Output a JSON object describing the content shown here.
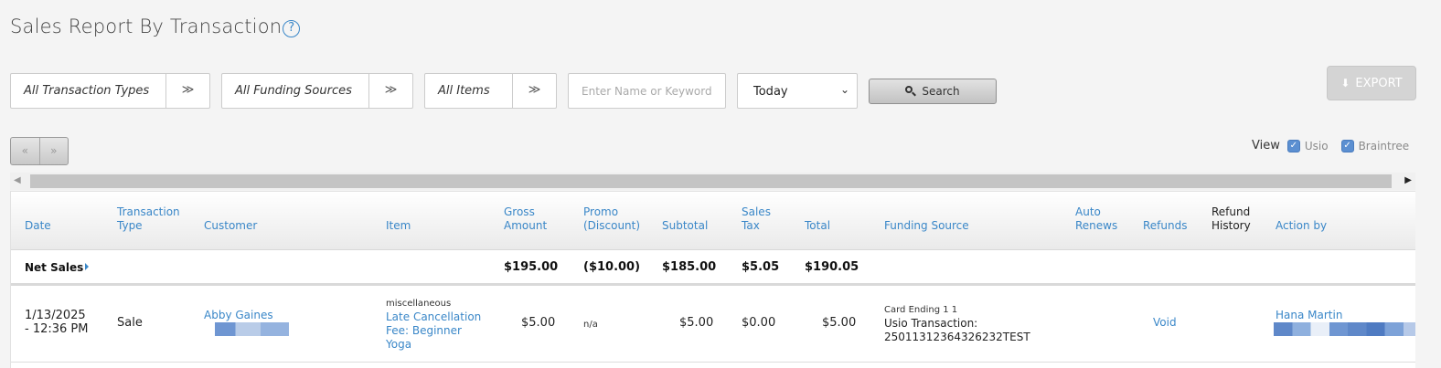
{
  "page": {
    "title": "Sales Report By Transaction",
    "help_icon": "?"
  },
  "filters": {
    "transaction_types": "All Transaction Types",
    "funding_sources": "All Funding Sources",
    "items": "All Items",
    "keyword_placeholder": "Enter Name or Keyword",
    "date_range": "Today",
    "chevron_glyph": "≫",
    "caret_glyph": "⌄"
  },
  "buttons": {
    "search": "Search",
    "export": "EXPORT"
  },
  "pager": {
    "prev": "«",
    "next": "»"
  },
  "view": {
    "label": "View",
    "options": [
      {
        "label": "Usio",
        "checked": true
      },
      {
        "label": "Braintree",
        "checked": true
      }
    ]
  },
  "columns": {
    "date": "Date",
    "transaction_type": [
      "Transaction",
      "Type"
    ],
    "customer": "Customer",
    "item": "Item",
    "gross_amount": [
      "Gross",
      "Amount"
    ],
    "promo": [
      "Promo",
      "(Discount)"
    ],
    "subtotal": "Subtotal",
    "sales_tax": [
      "Sales",
      "Tax"
    ],
    "total": "Total",
    "funding_source": "Funding Source",
    "auto_renews": [
      "Auto",
      "Renews"
    ],
    "refunds": "Refunds",
    "refund_history": [
      "Refund",
      "History"
    ],
    "action_by": "Action by"
  },
  "net_sales": {
    "label": "Net Sales",
    "gross": "$195.00",
    "promo": "($10.00)",
    "subtotal": "$185.00",
    "tax": "$5.05",
    "total": "$190.05"
  },
  "rows": [
    {
      "date": [
        "1/13/2025",
        "- 12:36 PM"
      ],
      "type": "Sale",
      "customer": "Abby Gaines",
      "item_category": "miscellaneous",
      "item": [
        "Late Cancellation",
        "Fee: Beginner",
        "Yoga"
      ],
      "gross": "$5.00",
      "promo": "n/a",
      "subtotal": "$5.00",
      "tax": "$0.00",
      "total": "$5.00",
      "card_label": "Card Ending 1 1",
      "funding_line1": "Usio Transaction:",
      "funding_line2": "25011312364326232TEST",
      "refund_action": "Void",
      "action_by": "Hana Martin"
    }
  ],
  "colors": {
    "link": "#3a87c8",
    "checkbox": "#5b8fd1",
    "export_disabled": "#d4d4d4"
  }
}
